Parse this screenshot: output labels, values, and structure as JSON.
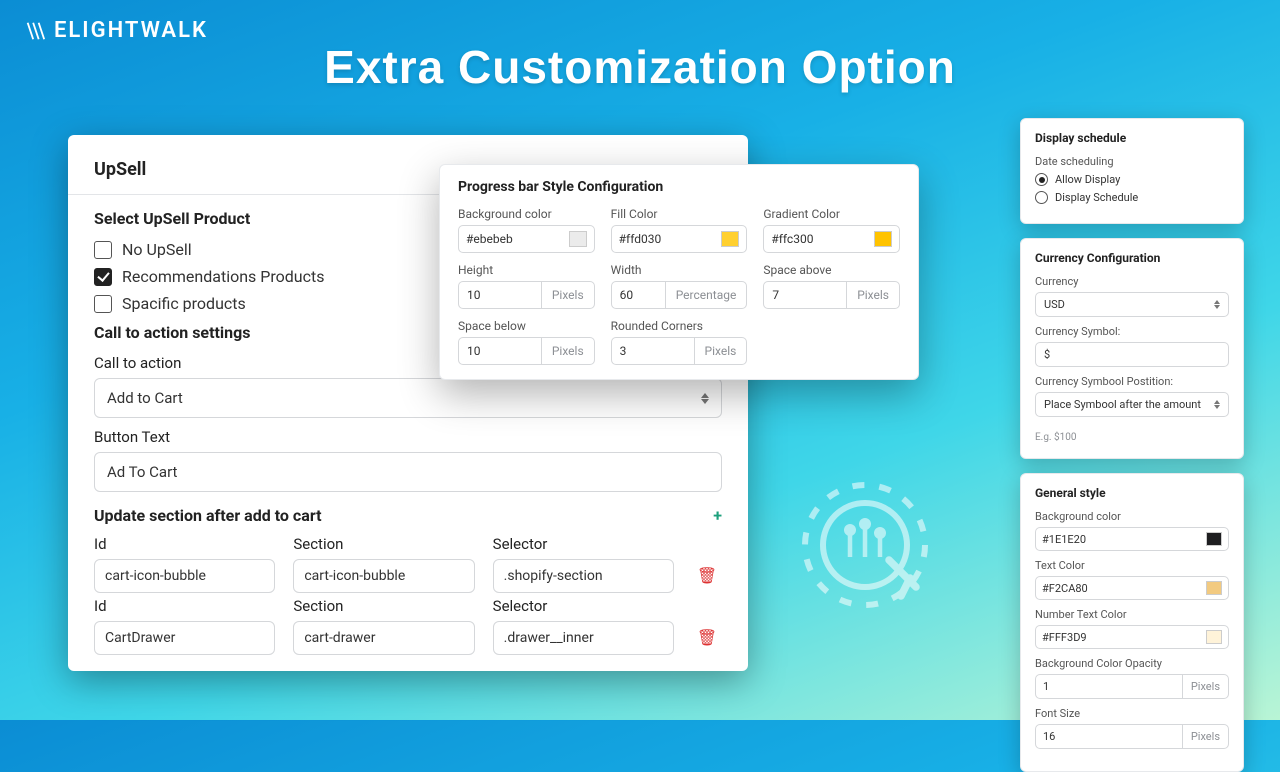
{
  "brand": "ELIGHTWALK",
  "hero": "Extra Customization Option",
  "upsell": {
    "title": "UpSell",
    "selectTitle": "Select UpSell Product",
    "options": [
      {
        "label": "No UpSell",
        "checked": false
      },
      {
        "label": "Recommendations Products",
        "checked": true
      },
      {
        "label": "Spacific products",
        "checked": false
      }
    ],
    "ctaTitle": "Call to action settings",
    "ctaLabel": "Call to action",
    "ctaValue": "Add to Cart",
    "btnTextLabel": "Button Text",
    "btnTextValue": "Ad To Cart",
    "updateTitle": "Update section after add to cart",
    "cols": {
      "id": "Id",
      "section": "Section",
      "selector": "Selector"
    },
    "rows": [
      {
        "id": "cart-icon-bubble",
        "section": "cart-icon-bubble",
        "selector": ".shopify-section"
      },
      {
        "id": "CartDrawer",
        "section": "cart-drawer",
        "selector": ".drawer__inner"
      }
    ]
  },
  "pb": {
    "title": "Progress bar Style Configuration",
    "bgLabel": "Background color",
    "bgValue": "#ebebeb",
    "fillLabel": "Fill Color",
    "fillValue": "#ffd030",
    "gradLabel": "Gradient Color",
    "gradValue": "#ffc300",
    "heightLabel": "Height",
    "heightValue": "10",
    "heightUnit": "Pixels",
    "widthLabel": "Width",
    "widthValue": "60",
    "widthUnit": "Percentage",
    "saLabel": "Space above",
    "saValue": "7",
    "saUnit": "Pixels",
    "sbLabel": "Space below",
    "sbValue": "10",
    "sbUnit": "Pixels",
    "rcLabel": "Rounded Corners",
    "rcValue": "3",
    "rcUnit": "Pixels"
  },
  "schedule": {
    "title": "Display schedule",
    "dateLabel": "Date scheduling",
    "allow": "Allow Display",
    "sched": "Display Schedule"
  },
  "currency": {
    "title": "Currency Configuration",
    "curLabel": "Currency",
    "curValue": "USD",
    "symLabel": "Currency Symbol:",
    "symValue": "$",
    "posLabel": "Currency Symbool Postition:",
    "posValue": "Place Symbool after the amount",
    "hint": "E.g. $100"
  },
  "general": {
    "title": "General style",
    "bgLabel": "Background color",
    "bgValue": "#1E1E20",
    "bgSwatch": "#1E1E20",
    "txtLabel": "Text Color",
    "txtValue": "#F2CA80",
    "txtSwatch": "#F2CA80",
    "numLabel": "Number Text Color",
    "numValue": "#FFF3D9",
    "numSwatch": "#FFF3D9",
    "opLabel": "Background Color Opacity",
    "opValue": "1",
    "opUnit": "Pixels",
    "fsLabel": "Font Size",
    "fsValue": "16",
    "fsUnit": "Pixels"
  }
}
